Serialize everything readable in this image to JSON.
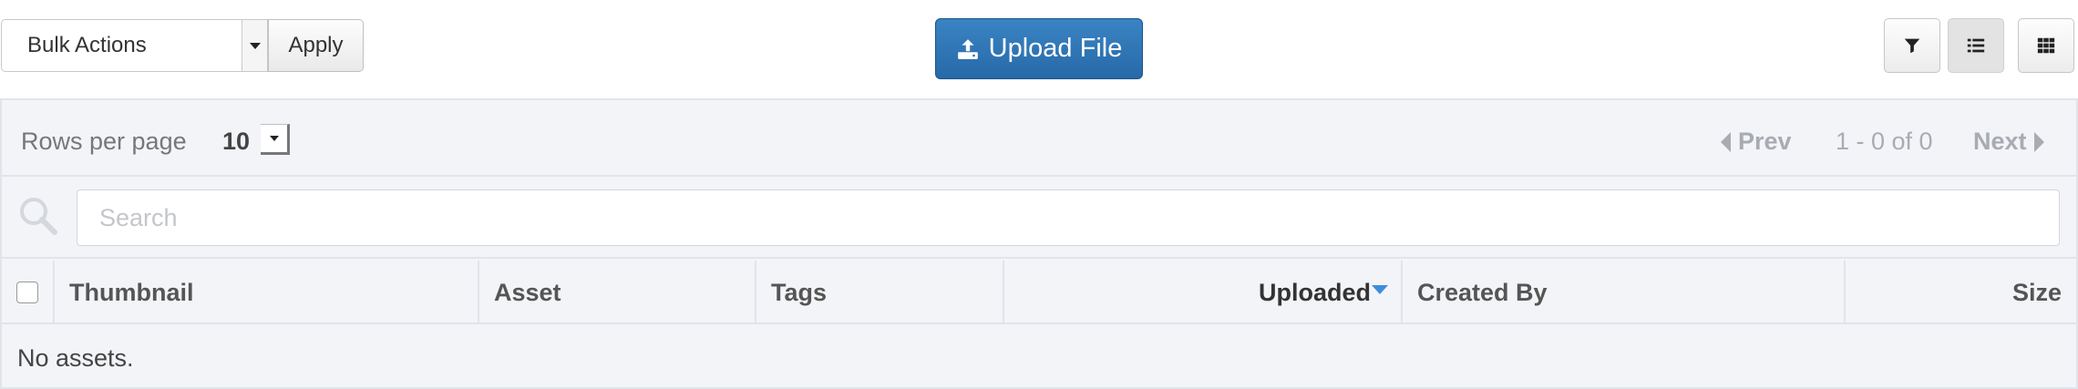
{
  "toolbar": {
    "bulk_actions": {
      "selected": "Bulk Actions"
    },
    "apply_label": "Apply",
    "upload_label": "Upload File",
    "view_buttons": [
      {
        "name": "filter",
        "icon": "filter-icon"
      },
      {
        "name": "list-view",
        "icon": "list-icon",
        "active": true
      },
      {
        "name": "grid-view",
        "icon": "grid-icon"
      }
    ]
  },
  "pager": {
    "rows_per_page_label": "Rows per page",
    "rows_per_page_value": "10",
    "prev_label": "Prev",
    "range_text": "1 - 0 of 0",
    "next_label": "Next"
  },
  "search": {
    "placeholder": "Search",
    "value": ""
  },
  "table": {
    "columns": [
      "Thumbnail",
      "Asset",
      "Tags",
      "Uploaded",
      "Created By",
      "Size"
    ],
    "sorted_column": "Uploaded",
    "sort_direction": "desc",
    "empty_message": "No assets."
  },
  "colors": {
    "primary_button": "#2b6fae",
    "sort_indicator": "#3d8fd8",
    "panel_bg": "#f3f4f8",
    "border": "#e1e4ea"
  }
}
